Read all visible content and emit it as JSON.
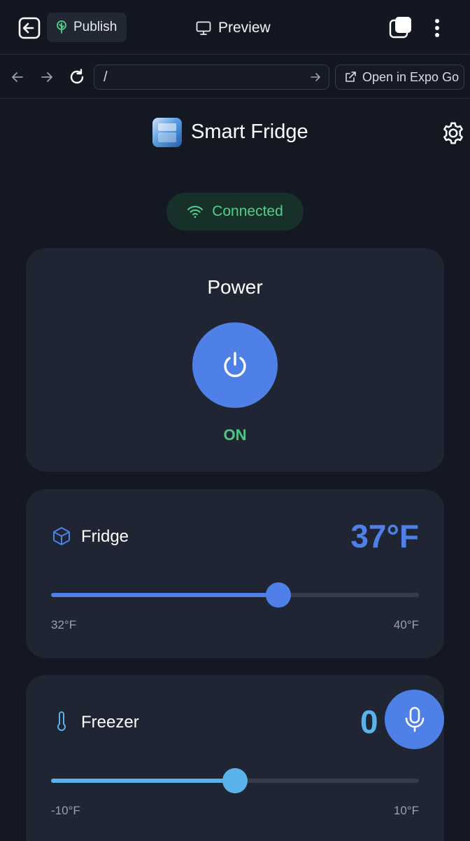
{
  "toolbar": {
    "publish_label": "Publish",
    "preview_label": "Preview"
  },
  "browser": {
    "url_value": "/",
    "open_expo_label": "Open in Expo Go"
  },
  "app": {
    "title": "Smart Fridge",
    "status": "Connected",
    "power": {
      "title": "Power",
      "state": "ON"
    },
    "fridge": {
      "label": "Fridge",
      "temperature": "37°F",
      "min_label": "32°F",
      "max_label": "40°F",
      "slider_fraction": 0.617
    },
    "freezer": {
      "label": "Freezer",
      "temperature_visible": "0",
      "min_label": "-10°F",
      "max_label": "10°F",
      "slider_fraction": 0.5
    }
  },
  "colors": {
    "accent_blue": "#4e80e8",
    "freezer_blue": "#5ab2ea",
    "success_green": "#4fc583",
    "card_bg": "#1f2532",
    "page_bg": "#131822"
  },
  "icons": {
    "exit": "exit-icon",
    "publish": "tree-icon",
    "preview": "monitor-icon",
    "device": "device-toggle-icon",
    "more": "more-vertical-icon",
    "back": "arrow-left-icon",
    "forward": "arrow-right-icon",
    "reload": "reload-icon",
    "go": "arrow-right-icon",
    "external": "external-link-icon",
    "settings": "gear-icon",
    "wifi": "wifi-icon",
    "power": "power-icon",
    "fridge": "cube-icon",
    "freezer": "thermometer-icon",
    "mic": "microphone-icon"
  }
}
